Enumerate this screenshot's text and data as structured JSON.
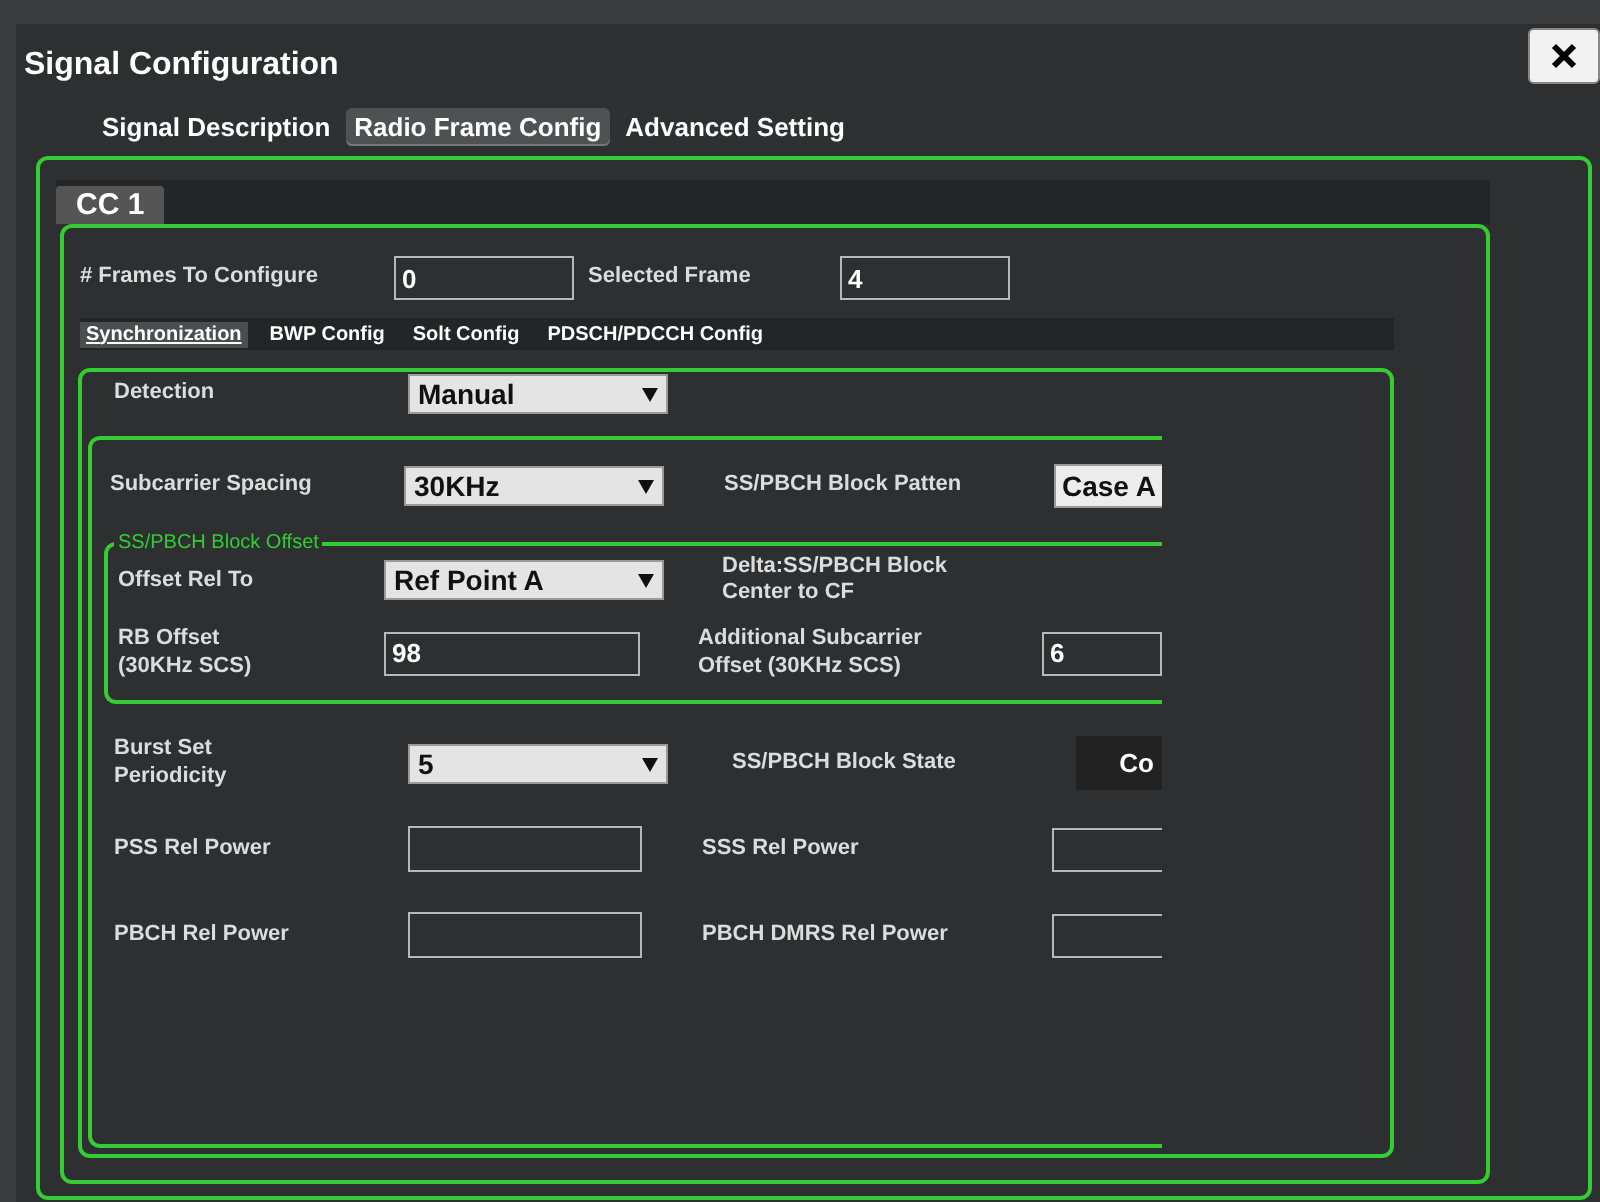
{
  "window": {
    "title": "Signal Configuration"
  },
  "tabs": [
    {
      "label": "Signal Description",
      "selected": false
    },
    {
      "label": "Radio Frame Config",
      "selected": true
    },
    {
      "label": "Advanced Setting",
      "selected": false
    }
  ],
  "carrier": {
    "label": "CC 1"
  },
  "frames": {
    "label": "# Frames To Configure",
    "value": "0",
    "selected_label": "Selected  Frame",
    "selected_value": "4"
  },
  "subtabs": [
    {
      "label": "Synchronization",
      "selected": true
    },
    {
      "label": "BWP Config",
      "selected": false
    },
    {
      "label": "Solt Config",
      "selected": false
    },
    {
      "label": "PDSCH/PDCCH Config",
      "selected": false
    }
  ],
  "detection": {
    "label": "Detection",
    "kind": "dropdown",
    "value": "Manual"
  },
  "spacing_row": {
    "left": {
      "label": "Subcarrier Spacing",
      "kind": "dropdown",
      "value": "30KHz"
    },
    "right": {
      "label": "SS/PBCH Block Patten",
      "kind": "readonly",
      "value": "Case A"
    }
  },
  "offset_group": {
    "title": "SS/PBCH Block Offset",
    "rows": [
      {
        "left": {
          "label": "Offset Rel To",
          "kind": "dropdown",
          "value": "Ref Point A"
        },
        "right": {
          "label": "Delta:SS/PBCH Block\nCenter to CF",
          "kind": "none"
        }
      },
      {
        "left": {
          "label": "RB Offset\n(30KHz SCS)",
          "kind": "input",
          "value": "98"
        },
        "right": {
          "label": "Additional Subcarrier\nOffset (30KHz SCS)",
          "kind": "input",
          "value": "6"
        }
      }
    ]
  },
  "rows": [
    {
      "left": {
        "label": "Burst Set\nPeriodicity",
        "kind": "dropdown",
        "value": "5"
      },
      "right": {
        "label": "SS/PBCH Block State",
        "kind": "button",
        "value": "Co"
      }
    },
    {
      "left": {
        "label": "PSS Rel Power",
        "kind": "input"
      },
      "right": {
        "label": "SSS Rel Power",
        "kind": "input"
      }
    },
    {
      "left": {
        "label": "PBCH Rel Power",
        "kind": "input"
      },
      "right": {
        "label": "PBCH DMRS Rel Power",
        "kind": "input"
      }
    }
  ]
}
